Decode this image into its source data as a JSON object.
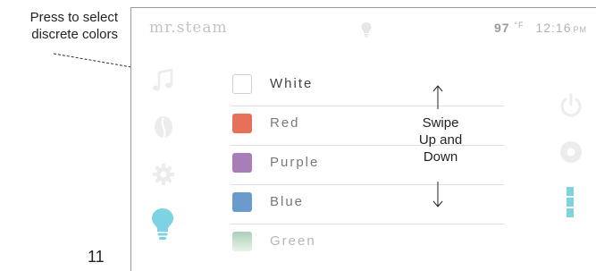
{
  "annotation": {
    "callout_line1": "Press to select",
    "callout_line2": "discrete colors",
    "swipe_line1": "Swipe",
    "swipe_line2": "Up and",
    "swipe_line3": "Down",
    "page_number": "11"
  },
  "header": {
    "brand": "mr.steam",
    "temperature": "97",
    "temp_unit": "°F",
    "time": "12:16",
    "ampm": "PM"
  },
  "colors_list": [
    {
      "label": "White",
      "color": "#ffffff"
    },
    {
      "label": "Red",
      "color": "#e6705a"
    },
    {
      "label": "Purple",
      "color": "#a87eb9"
    },
    {
      "label": "Blue",
      "color": "#6a9bcc"
    },
    {
      "label": "Green",
      "color": "#6aa87f"
    }
  ],
  "left_icons": [
    "music-note-icon",
    "leaf-icon",
    "gear-icon",
    "lightbulb-icon"
  ],
  "right_icons": [
    "power-icon",
    "record-icon",
    "level-bars-icon"
  ],
  "theme": {
    "accent": "#7ed3e3",
    "icon_inactive": "#ececec"
  }
}
